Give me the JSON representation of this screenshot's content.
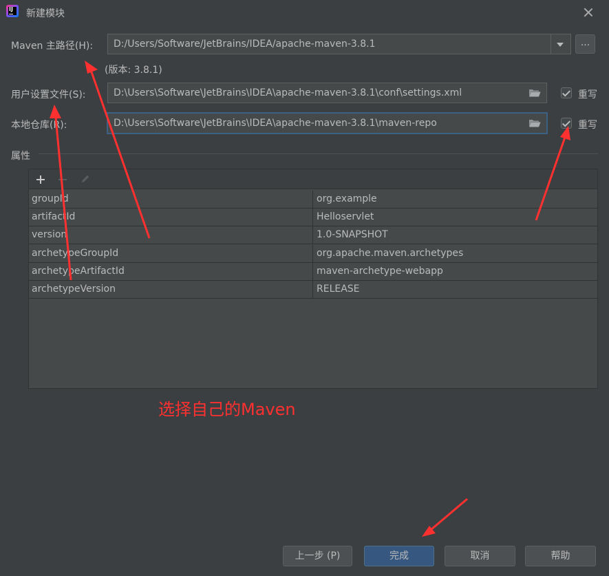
{
  "window": {
    "title": "新建模块"
  },
  "maven_home": {
    "label": "Maven 主路径(H):",
    "value": "D:/Users/Software/JetBrains/IDEA/apache-maven-3.8.1",
    "browse_label": "...",
    "version": "(版本: 3.8.1)"
  },
  "settings_file": {
    "label": "用户设置文件(S):",
    "value": "D:\\Users\\Software\\JetBrains\\IDEA\\apache-maven-3.8.1\\conf\\settings.xml",
    "override_label": "重写",
    "override_checked": true
  },
  "local_repo": {
    "label": "本地仓库(R):",
    "value": "D:\\Users\\Software\\JetBrains\\IDEA\\apache-maven-3.8.1\\maven-repo",
    "override_label": "重写",
    "override_checked": true
  },
  "properties": {
    "title": "属性",
    "rows": [
      {
        "key": "groupId",
        "value": "org.example"
      },
      {
        "key": "artifactId",
        "value": "Helloservlet"
      },
      {
        "key": "version",
        "value": "1.0-SNAPSHOT"
      },
      {
        "key": "archetypeGroupId",
        "value": "org.apache.maven.archetypes"
      },
      {
        "key": "archetypeArtifactId",
        "value": "maven-archetype-webapp"
      },
      {
        "key": "archetypeVersion",
        "value": "RELEASE"
      }
    ]
  },
  "annotation": "选择自己的Maven",
  "buttons": {
    "previous": "上一步 (P)",
    "finish": "完成",
    "cancel": "取消",
    "help": "帮助"
  },
  "colors": {
    "background": "#3c3f41",
    "annotation": "#ff3030",
    "primary_button": "#365880"
  }
}
